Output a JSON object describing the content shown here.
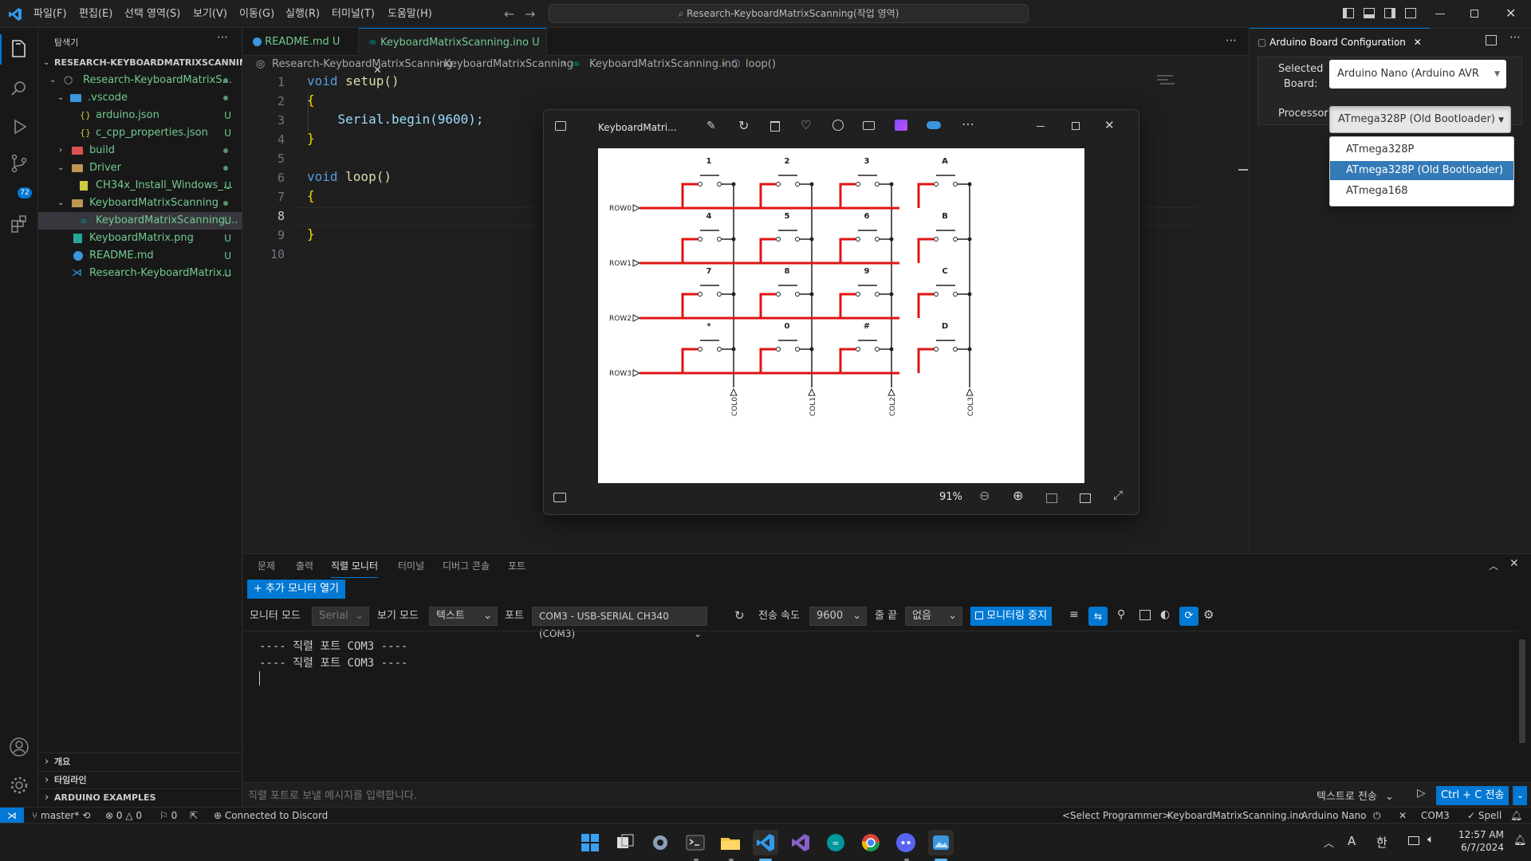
{
  "titlebar": {
    "menus": [
      "파일(F)",
      "편집(E)",
      "선택 영역(S)",
      "보기(V)",
      "이동(G)",
      "실행(R)",
      "터미널(T)",
      "도움말(H)"
    ],
    "command_center": "Research-KeyboardMatrixScanning(작업 영역)"
  },
  "activity": {
    "source_control_badge": "72"
  },
  "sidebar": {
    "title": "탐색기",
    "workspace": "RESEARCH-KEYBOARDMATRIXSCANNING(...",
    "items": [
      {
        "label": "Research-KeyboardMatrixS...",
        "status": "dot"
      },
      {
        "label": ".vscode",
        "status": "dot"
      },
      {
        "label": "arduino.json",
        "status": "U"
      },
      {
        "label": "c_cpp_properties.json",
        "status": "U"
      },
      {
        "label": "build",
        "status": "dot"
      },
      {
        "label": "Driver",
        "status": "dot"
      },
      {
        "label": "CH34x_Install_Windows_...",
        "status": "U"
      },
      {
        "label": "KeyboardMatrixScanning",
        "status": "dot"
      },
      {
        "label": "KeyboardMatrixScanning....",
        "status": "U"
      },
      {
        "label": "KeyboardMatrix.png",
        "status": "U"
      },
      {
        "label": "README.md",
        "status": "U"
      },
      {
        "label": "Research-KeyboardMatrix...",
        "status": "U"
      }
    ],
    "bottom_sections": [
      "개요",
      "타임라인",
      "ARDUINO EXAMPLES"
    ]
  },
  "tabs": [
    {
      "label": "README.md",
      "status": "U"
    },
    {
      "label": "KeyboardMatrixScanning.ino",
      "status": "U"
    }
  ],
  "breadcrumb": [
    "Research-KeyboardMatrixScanning",
    "KeyboardMatrixScanning",
    "KeyboardMatrixScanning.ino",
    "loop()"
  ],
  "code": {
    "line_numbers": [
      "1",
      "2",
      "3",
      "4",
      "5",
      "6",
      "7",
      "8",
      "9",
      "10"
    ],
    "lines": [
      {
        "kw": "void",
        "rest": " setup()"
      },
      {
        "kw": "",
        "rest": "{"
      },
      {
        "kw": "",
        "rest": "    Serial.begin(9600);"
      },
      {
        "kw": "",
        "rest": "}"
      },
      {
        "kw": "",
        "rest": ""
      },
      {
        "kw": "void",
        "rest": " loop()"
      },
      {
        "kw": "",
        "rest": "{"
      },
      {
        "kw": "",
        "rest": ""
      },
      {
        "kw": "",
        "rest": "}"
      },
      {
        "kw": "",
        "rest": ""
      }
    ]
  },
  "board_config": {
    "tab_title": "Arduino Board Configuration",
    "selected_board_label_1": "Selected",
    "selected_board_label_2": "Board:",
    "selected_board_value": "Arduino Nano (Arduino AVR",
    "processor_label": "Processor",
    "processor_value": "ATmega328P (Old Bootloader)",
    "processor_options": [
      "ATmega328P",
      "ATmega328P (Old Bootloader)",
      "ATmega168"
    ],
    "processor_selected_index": 1
  },
  "viewer": {
    "title": "KeyboardMatri...",
    "zoom": "91%",
    "keys": [
      "1",
      "2",
      "3",
      "A",
      "4",
      "5",
      "6",
      "B",
      "7",
      "8",
      "9",
      "C",
      "*",
      "0",
      "#",
      "D"
    ],
    "rows": [
      "ROW0",
      "ROW1",
      "ROW2",
      "ROW3"
    ],
    "cols": [
      "COL0",
      "COL1",
      "COL2",
      "COL3"
    ]
  },
  "panel": {
    "tabs": [
      "문제",
      "출력",
      "직렬 모니터",
      "터미널",
      "디버그 콘솔",
      "포트"
    ],
    "active_tab": 2,
    "add_monitor_button": "+ 추가 모니터 열기",
    "monitor_mode_label": "모니터 모드",
    "monitor_mode_value": "Serial",
    "view_mode_label": "보기 모드",
    "view_mode_value": "텍스트",
    "port_label": "포트",
    "port_value": "COM3 - USB-SERIAL CH340 (COM3)",
    "baud_label": "전송 속도",
    "baud_value": "9600",
    "line_end_label": "줄 끝",
    "line_end_value": "없음",
    "stop_button": "모니터링 중지",
    "output_lines": [
      "---- 직렬 포트 COM3 ----",
      "---- 직렬 포트 COM3 ----"
    ],
    "input_placeholder": "직렬 포트로 보낼 메시지를 입력합니다.",
    "send_mode": "텍스트로 전송",
    "ctrl_c_button": "Ctrl + C 전송"
  },
  "status": {
    "branch": "master*",
    "errors": "0",
    "warnings": "0",
    "ports": "0",
    "discord": "Connected to Discord",
    "programmer": "<Select Programmer>",
    "sketch": "KeyboardMatrixScanning.ino",
    "board": "Arduino Nano",
    "port": "COM3",
    "spell": "Spell"
  },
  "taskbar": {
    "time": "12:57 AM",
    "date": "6/7/2024",
    "ime_a": "A",
    "ime_han": "한"
  },
  "colors": {
    "accent": "#0078d4",
    "wire_red": "#e01414",
    "untracked_green": "#73c991"
  }
}
